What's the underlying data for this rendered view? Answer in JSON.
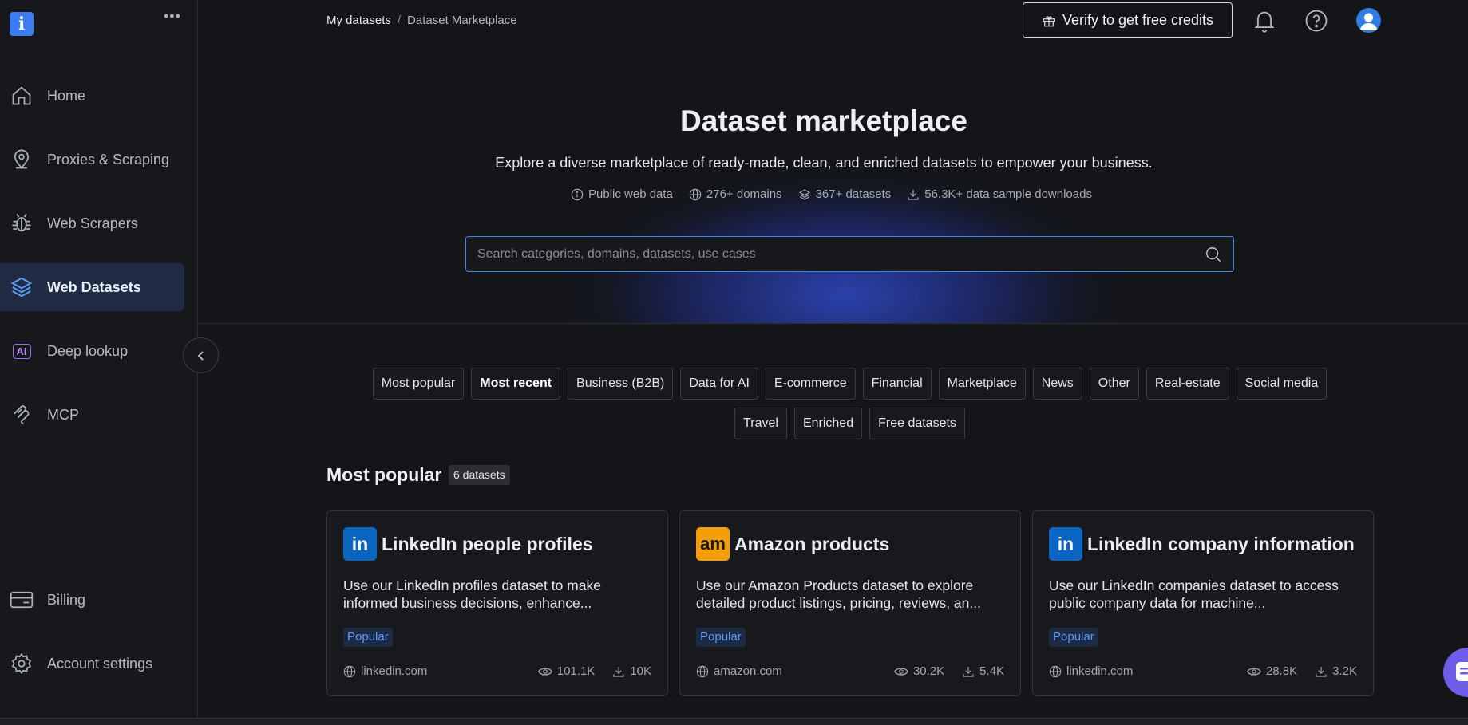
{
  "app": {
    "logo_glyph": "i",
    "more_glyph": "•••"
  },
  "sidebar": {
    "items": [
      {
        "label": "Home",
        "icon": "home-icon"
      },
      {
        "label": "Proxies & Scraping",
        "icon": "map-pin-icon"
      },
      {
        "label": "Web Scrapers",
        "icon": "bug-icon"
      },
      {
        "label": "Web Datasets",
        "icon": "layers-icon",
        "active": true
      },
      {
        "label": "Deep lookup",
        "icon": "ai-icon",
        "icon_text": "AI"
      },
      {
        "label": "MCP",
        "icon": "mcp-icon"
      }
    ],
    "bottom_items": [
      {
        "label": "Billing",
        "icon": "credit-card-icon"
      },
      {
        "label": "Account settings",
        "icon": "gear-icon"
      }
    ]
  },
  "header": {
    "breadcrumb": [
      "My datasets",
      "Dataset Marketplace"
    ],
    "breadcrumb_separator": "/",
    "verify_label": "Verify to get free credits"
  },
  "hero": {
    "title": "Dataset marketplace",
    "subtitle": "Explore a diverse marketplace of ready-made, clean, and enriched datasets to empower your business.",
    "stats": [
      {
        "icon": "info-icon",
        "text": "Public web data"
      },
      {
        "icon": "globe-icon",
        "text": "276+ domains"
      },
      {
        "icon": "layers-icon",
        "text": "367+ datasets"
      },
      {
        "icon": "download-icon",
        "text": "56.3K+ data sample downloads"
      }
    ],
    "search_placeholder": "Search categories, domains, datasets, use cases"
  },
  "filters": {
    "row1": [
      "Most popular",
      "Most recent",
      "Business (B2B)",
      "Data for AI",
      "E-commerce",
      "Financial",
      "Marketplace",
      "News",
      "Other",
      "Real-estate",
      "Social media"
    ],
    "row2": [
      "Travel",
      "Enriched",
      "Free datasets"
    ],
    "selected": "Most recent"
  },
  "section": {
    "title": "Most popular",
    "count": "6 datasets"
  },
  "cards": [
    {
      "logo_text": "in",
      "logo_color": "#0a66c2",
      "title": "LinkedIn people profiles",
      "description": "Use our LinkedIn profiles dataset to make informed business decisions, enhance...",
      "badge": "Popular",
      "domain": "linkedin.com",
      "views": "101.1K",
      "downloads": "10K"
    },
    {
      "logo_text": "am",
      "logo_color": "#f59e0b",
      "title": "Amazon products",
      "description": "Use our Amazon Products dataset to explore detailed product listings, pricing, reviews, an...",
      "badge": "Popular",
      "domain": "amazon.com",
      "views": "30.2K",
      "downloads": "5.4K"
    },
    {
      "logo_text": "in",
      "logo_color": "#0a66c2",
      "title": "LinkedIn company information",
      "description": "Use our LinkedIn companies dataset to access public company data for machine...",
      "badge": "Popular",
      "domain": "linkedin.com",
      "views": "28.8K",
      "downloads": "3.2K"
    }
  ],
  "colors": {
    "accent": "#3b86f7",
    "badge_text": "#5a9af5",
    "background": "#141518"
  }
}
